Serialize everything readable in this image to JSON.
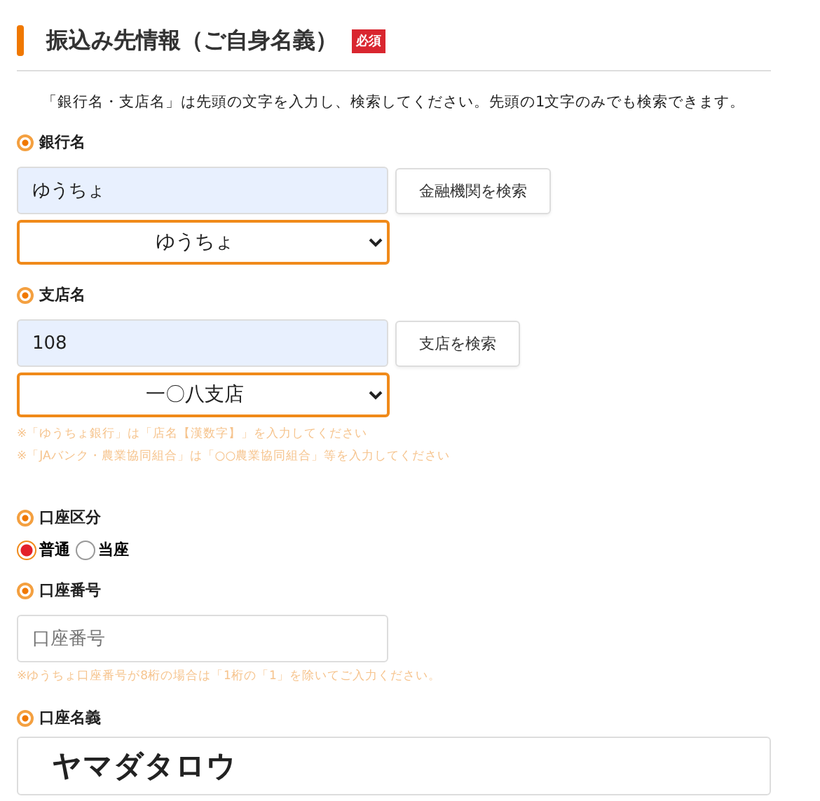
{
  "heading": {
    "title": "振込み先情報（ご自身名義）",
    "badge": "必須"
  },
  "intro": "「銀行名・支店名」は先頭の文字を入力し、検索してください。先頭の1文字のみでも検索できます。",
  "bank": {
    "label": "銀行名",
    "value": "ゆうちょ",
    "button": "金融機関を検索",
    "selected_option": "ゆうちょ"
  },
  "branch": {
    "label": "支店名",
    "value": "108",
    "button": "支店を検索",
    "selected_option": "一〇八支店",
    "notes": [
      "※「ゆうちょ銀行」は「店名【漢数字】」を入力してください",
      "※「JAバンク・農業協同組合」は「○○農業協同組合」等を入力してください"
    ]
  },
  "account_type": {
    "label": "口座区分",
    "options": [
      {
        "label": "普通",
        "selected": true
      },
      {
        "label": "当座",
        "selected": false
      }
    ]
  },
  "account_number": {
    "label": "口座番号",
    "placeholder": "口座番号",
    "note": "※ゆうちょ口座番号が8桁の場合は「1桁の「1」を除いてご入力ください。"
  },
  "account_name": {
    "label": "口座名義",
    "value": "ヤマダタロウ"
  }
}
